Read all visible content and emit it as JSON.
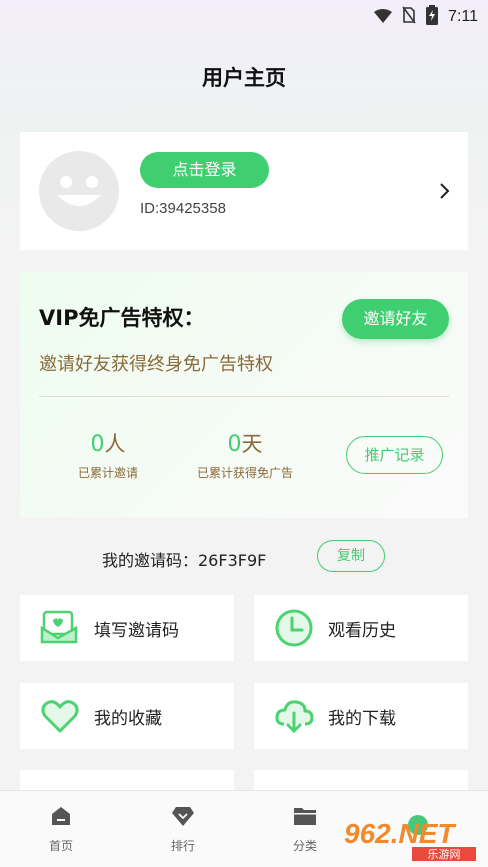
{
  "status_bar": {
    "time": "7:11",
    "icons": [
      "wifi-icon",
      "no-sim-icon",
      "battery-charging-icon"
    ]
  },
  "header": {
    "title": "用户主页"
  },
  "profile": {
    "login_label": "点击登录",
    "user_id": "ID:39425358",
    "avatar_icon": "smiley-avatar",
    "chevron_icon": "chevron-right-icon"
  },
  "vip": {
    "title": "VIP免广告特权：",
    "invite_label": "邀请好友",
    "subtitle": "邀请好友获得终身免广告特权",
    "stats": [
      {
        "value": "0",
        "unit": "人",
        "label": "已累计邀请"
      },
      {
        "value": "0",
        "unit": "天",
        "label": "已累计获得免广告"
      }
    ],
    "record_label": "推广记录"
  },
  "invite_code": {
    "text": "我的邀请码：26F3F9F",
    "copy_label": "复制"
  },
  "tiles": [
    {
      "label": "填写邀请码",
      "icon": "envelope-heart-icon"
    },
    {
      "label": "观看历史",
      "icon": "clock-icon"
    },
    {
      "label": "我的收藏",
      "icon": "heart-icon"
    },
    {
      "label": "我的下载",
      "icon": "cloud-download-icon"
    }
  ],
  "bottom_nav": [
    {
      "label": "首页",
      "icon": "home-icon"
    },
    {
      "label": "排行",
      "icon": "diamond-icon"
    },
    {
      "label": "分类",
      "icon": "folder-icon"
    }
  ],
  "watermark": {
    "text": "962.NET",
    "subtext": "乐游网"
  },
  "colors": {
    "accent": "#3fcf70",
    "gold_text": "#8a6a3a",
    "card": "#ffffff"
  }
}
